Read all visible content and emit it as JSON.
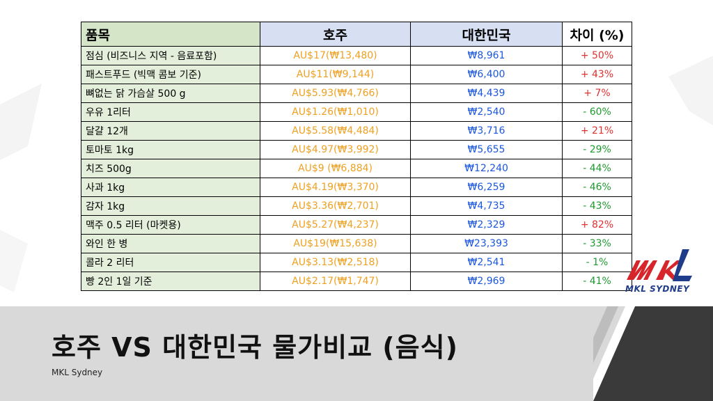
{
  "table": {
    "headers": {
      "item": "품목",
      "au": "호주",
      "kr": "대한민국",
      "diff": "차이 (%)"
    },
    "rows": [
      {
        "item": "점심 (비즈니스 지역 - 음료포함)",
        "au": "AU$17(₩13,480)",
        "kr": "₩8,961",
        "diff": "+ 50%",
        "sign": "pos"
      },
      {
        "item": "패스트푸드 (빅맥 콤보 기준)",
        "au": "AU$11(₩9,144)",
        "kr": "₩6,400",
        "diff": "+ 43%",
        "sign": "pos"
      },
      {
        "item": "뼈없는 닭 가슴살 500 g",
        "au": "AU$5.93(₩4,766)",
        "kr": "₩4,439",
        "diff": "+ 7%",
        "sign": "pos"
      },
      {
        "item": "우유 1리터",
        "au": "AU$1.26(₩1,010)",
        "kr": "₩2,540",
        "diff": "- 60%",
        "sign": "neg"
      },
      {
        "item": "달걀 12개",
        "au": "AU$5.58(₩4,484)",
        "kr": "₩3,716",
        "diff": "+ 21%",
        "sign": "pos"
      },
      {
        "item": "토마토 1kg",
        "au": "AU$4.97(₩3,992)",
        "kr": "₩5,655",
        "diff": "- 29%",
        "sign": "neg"
      },
      {
        "item": "치즈 500g",
        "au": "AU$9 (₩6,884)",
        "kr": "₩12,240",
        "diff": "- 44%",
        "sign": "neg"
      },
      {
        "item": "사과 1kg",
        "au": "AU$4.19(₩3,370)",
        "kr": "₩6,259",
        "diff": "- 46%",
        "sign": "neg"
      },
      {
        "item": "감자 1kg",
        "au": "AU$3.36(₩2,701)",
        "kr": "₩4,735",
        "diff": "- 43%",
        "sign": "neg"
      },
      {
        "item": "맥주 0.5 리터 (마켓용)",
        "au": "AU$5.27(₩4,237)",
        "kr": "₩2,329",
        "diff": "+ 82%",
        "sign": "pos"
      },
      {
        "item": "와인 한 병",
        "au": "AU$19(₩15,638)",
        "kr": "₩23,393",
        "diff": "- 33%",
        "sign": "neg"
      },
      {
        "item": "콜라 2 리터",
        "au": "AU$3.13(₩2,518)",
        "kr": "₩2,541",
        "diff": "- 1%",
        "sign": "neg"
      },
      {
        "item": "빵 2인 1일 기준",
        "au": "AU$2.17(₩1,747)",
        "kr": "₩2,969",
        "diff": "- 41%",
        "sign": "neg"
      }
    ]
  },
  "slide": {
    "title": "호주 VS 대한민국 물가비교 (음식)",
    "subtitle": "MKL Sydney"
  },
  "logo": {
    "text": "MKL SYDNEY"
  },
  "colors": {
    "au_text": "#f0a020",
    "kr_text": "#1a56e0",
    "positive": "#e03030",
    "negative": "#1f9a2f",
    "logo_red": "#d7262b",
    "logo_blue": "#1e3c8a"
  }
}
